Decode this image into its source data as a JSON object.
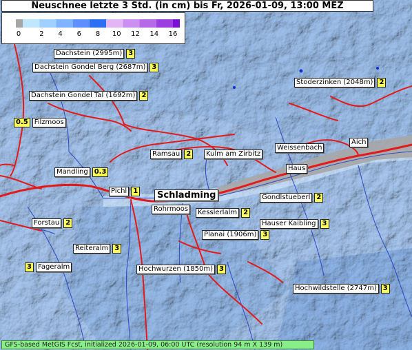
{
  "title": "Neuschnee letzte 3 Std. (in cm) bis Fr, 2026-01-09, 13:00 MEZ",
  "legend": {
    "colors": [
      "#a6a6a6",
      "#bfe8ff",
      "#9fd0ff",
      "#7fb3ff",
      "#5e8fff",
      "#2d6ff2",
      "#e3b5f5",
      "#cc8ef0",
      "#b56ae8",
      "#9b3fe0",
      "#7a10d8"
    ],
    "ticks": [
      "0",
      "2",
      "4",
      "6",
      "8",
      "10",
      "12",
      "14",
      "16"
    ]
  },
  "locations": [
    {
      "name": "Dachstein (2995m)",
      "value": "3"
    },
    {
      "name": "Dachstein Gondel Berg (2687m)",
      "value": "3"
    },
    {
      "name": "Dachstein Gondel Tal (1692m)",
      "value": "2"
    },
    {
      "name": "Stoderzinken (2048m)",
      "value": "2"
    },
    {
      "name": "Filzmoos",
      "value": "0.5"
    },
    {
      "name": "Ramsau",
      "value": "2"
    },
    {
      "name": "Kulm am Zirbitz",
      "value": ""
    },
    {
      "name": "Weissenbach",
      "value": ""
    },
    {
      "name": "Aich",
      "value": ""
    },
    {
      "name": "Mandling",
      "value": "0.3"
    },
    {
      "name": "Haus",
      "value": ""
    },
    {
      "name": "Pichl",
      "value": "1"
    },
    {
      "name": "Schladming",
      "value": ""
    },
    {
      "name": "Gondlstueberl",
      "value": "2"
    },
    {
      "name": "Rohrmoos",
      "value": ""
    },
    {
      "name": "Kesslerlalm",
      "value": "2"
    },
    {
      "name": "Forstau",
      "value": "2"
    },
    {
      "name": "Hauser Kaibling",
      "value": "3"
    },
    {
      "name": "Planai (1906m)",
      "value": "3"
    },
    {
      "name": "Reiteralm",
      "value": "3"
    },
    {
      "name": "Fageralm",
      "value": "3"
    },
    {
      "name": "Hochwurzen (1850m)",
      "value": "3"
    },
    {
      "name": "Hochwildstelle (2747m)",
      "value": "3"
    }
  ],
  "footer": "GFS-based MetGIS Fcst, initialized 2026-01-09, 06:00 UTC  (resolution 94 m X 139 m)"
}
